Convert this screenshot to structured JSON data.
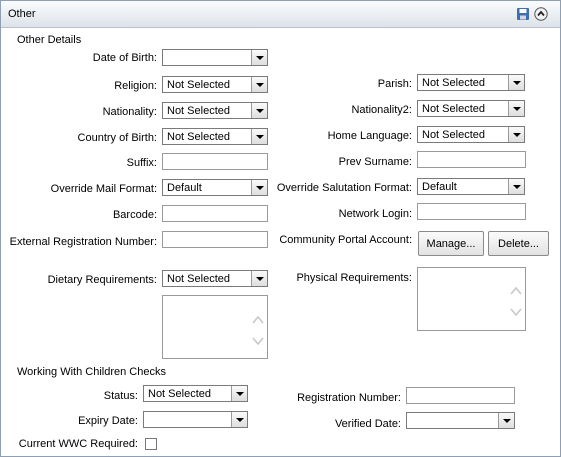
{
  "panel": {
    "title": "Other",
    "save_icon": "save-icon",
    "collapse_icon": "collapse-icon"
  },
  "other_details": {
    "heading": "Other Details",
    "dob_label": "Date of Birth:",
    "dob_value": "",
    "religion_label": "Religion:",
    "religion_value": "Not Selected",
    "parish_label": "Parish:",
    "parish_value": "Not Selected",
    "nationality_label": "Nationality:",
    "nationality_value": "Not Selected",
    "nationality2_label": "Nationality2:",
    "nationality2_value": "Not Selected",
    "country_label": "Country of Birth:",
    "country_value": "Not Selected",
    "home_language_label": "Home Language:",
    "home_language_value": "Not Selected",
    "suffix_label": "Suffix:",
    "suffix_value": "",
    "prev_surname_label": "Prev Surname:",
    "prev_surname_value": "",
    "mail_format_label": "Override Mail Format:",
    "mail_format_value": "Default",
    "salutation_label": "Override Salutation Format:",
    "salutation_value": "Default",
    "barcode_label": "Barcode:",
    "barcode_value": "",
    "network_login_label": "Network Login:",
    "network_login_value": "",
    "ext_reg_label": "External Registration Number:",
    "ext_reg_value": "",
    "portal_label": "Community Portal Account:",
    "manage_button": "Manage...",
    "delete_button": "Delete...",
    "dietary_label": "Dietary Requirements:",
    "dietary_value": "Not Selected",
    "physical_label": "Physical Requirements:"
  },
  "wwc": {
    "heading": "Working With Children Checks",
    "status_label": "Status:",
    "status_value": "Not Selected",
    "reg_number_label": "Registration Number:",
    "reg_number_value": "",
    "expiry_label": "Expiry Date:",
    "expiry_value": "",
    "verified_label": "Verified Date:",
    "verified_value": "",
    "current_label": "Current WWC Required:",
    "current_checked": false
  },
  "colors": {
    "header_border": "#8e9eb3",
    "icon_blue": "#3f6fb0"
  }
}
